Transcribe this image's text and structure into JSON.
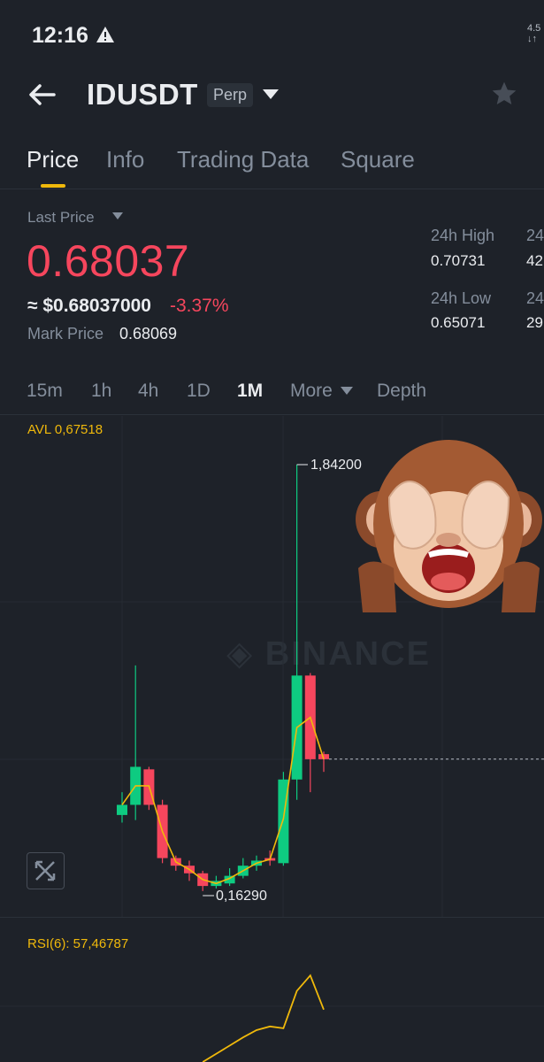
{
  "status_bar": {
    "time": "12:16",
    "right_top": "4.5",
    "right_bottom": "↓↑"
  },
  "header": {
    "symbol": "IDUSDT",
    "badge": "Perp"
  },
  "tabs": [
    {
      "label": "Price",
      "active": true
    },
    {
      "label": "Info",
      "active": false
    },
    {
      "label": "Trading Data",
      "active": false
    },
    {
      "label": "Square",
      "active": false
    }
  ],
  "price": {
    "last_price_label": "Last Price",
    "last_price": "0.68037",
    "usd_price": "≈ $0.68037000",
    "change": "-3.37%",
    "mark_label": "Mark Price",
    "mark_value": "0.68069"
  },
  "stats": {
    "high_label": "24h High",
    "high_value": "0.70731",
    "low_label": "24h Low",
    "low_value": "0.65071",
    "col2_label_top": "24",
    "col2_value_top": "42",
    "col2_label_bottom": "24",
    "col2_value_bottom": "29"
  },
  "intervals": [
    {
      "label": "15m",
      "active": false
    },
    {
      "label": "1h",
      "active": false
    },
    {
      "label": "4h",
      "active": false
    },
    {
      "label": "1D",
      "active": false
    },
    {
      "label": "1M",
      "active": true
    },
    {
      "label": "More",
      "active": false
    },
    {
      "label": "Depth",
      "active": false
    }
  ],
  "chart": {
    "avl_label": "AVL 0,67518",
    "high_marker": "1,84200",
    "low_marker": "0,16290",
    "watermark": "BINANCE",
    "rsi_label": "RSI(6): 57,46787"
  },
  "colors": {
    "up": "#0ecb81",
    "down": "#f6465d",
    "accent": "#f0b90b",
    "bg": "#1e2229"
  },
  "chart_data": {
    "type": "candlestick",
    "price_range_shown": [
      0.1629,
      1.842
    ],
    "avl": 0.67518,
    "high": 1.842,
    "low": 0.1629,
    "candles": [
      {
        "open": 0.46,
        "high": 0.55,
        "low": 0.43,
        "close": 0.5,
        "dir": "up"
      },
      {
        "open": 0.5,
        "high": 1.05,
        "low": 0.44,
        "close": 0.65,
        "dir": "up"
      },
      {
        "open": 0.64,
        "high": 0.65,
        "low": 0.48,
        "close": 0.5,
        "dir": "down"
      },
      {
        "open": 0.5,
        "high": 0.52,
        "low": 0.27,
        "close": 0.29,
        "dir": "down"
      },
      {
        "open": 0.29,
        "high": 0.3,
        "low": 0.24,
        "close": 0.26,
        "dir": "down"
      },
      {
        "open": 0.26,
        "high": 0.28,
        "low": 0.2,
        "close": 0.23,
        "dir": "down"
      },
      {
        "open": 0.23,
        "high": 0.24,
        "low": 0.16,
        "close": 0.18,
        "dir": "down"
      },
      {
        "open": 0.18,
        "high": 0.22,
        "low": 0.17,
        "close": 0.2,
        "dir": "up"
      },
      {
        "open": 0.19,
        "high": 0.25,
        "low": 0.18,
        "close": 0.22,
        "dir": "up"
      },
      {
        "open": 0.22,
        "high": 0.29,
        "low": 0.21,
        "close": 0.26,
        "dir": "up"
      },
      {
        "open": 0.26,
        "high": 0.3,
        "low": 0.24,
        "close": 0.28,
        "dir": "up"
      },
      {
        "open": 0.28,
        "high": 0.32,
        "low": 0.26,
        "close": 0.29,
        "dir": "down"
      },
      {
        "open": 0.27,
        "high": 0.63,
        "low": 0.26,
        "close": 0.6,
        "dir": "up"
      },
      {
        "open": 0.6,
        "high": 1.842,
        "low": 0.52,
        "close": 1.01,
        "dir": "up"
      },
      {
        "open": 1.01,
        "high": 1.02,
        "low": 0.55,
        "close": 0.68,
        "dir": "down"
      },
      {
        "open": 0.7,
        "high": 0.71,
        "low": 0.63,
        "close": 0.68,
        "dir": "down"
      }
    ],
    "rsi_values": [
      null,
      null,
      null,
      null,
      null,
      null,
      null,
      null,
      null,
      null,
      35,
      39,
      37,
      78,
      95,
      57.46787
    ]
  }
}
